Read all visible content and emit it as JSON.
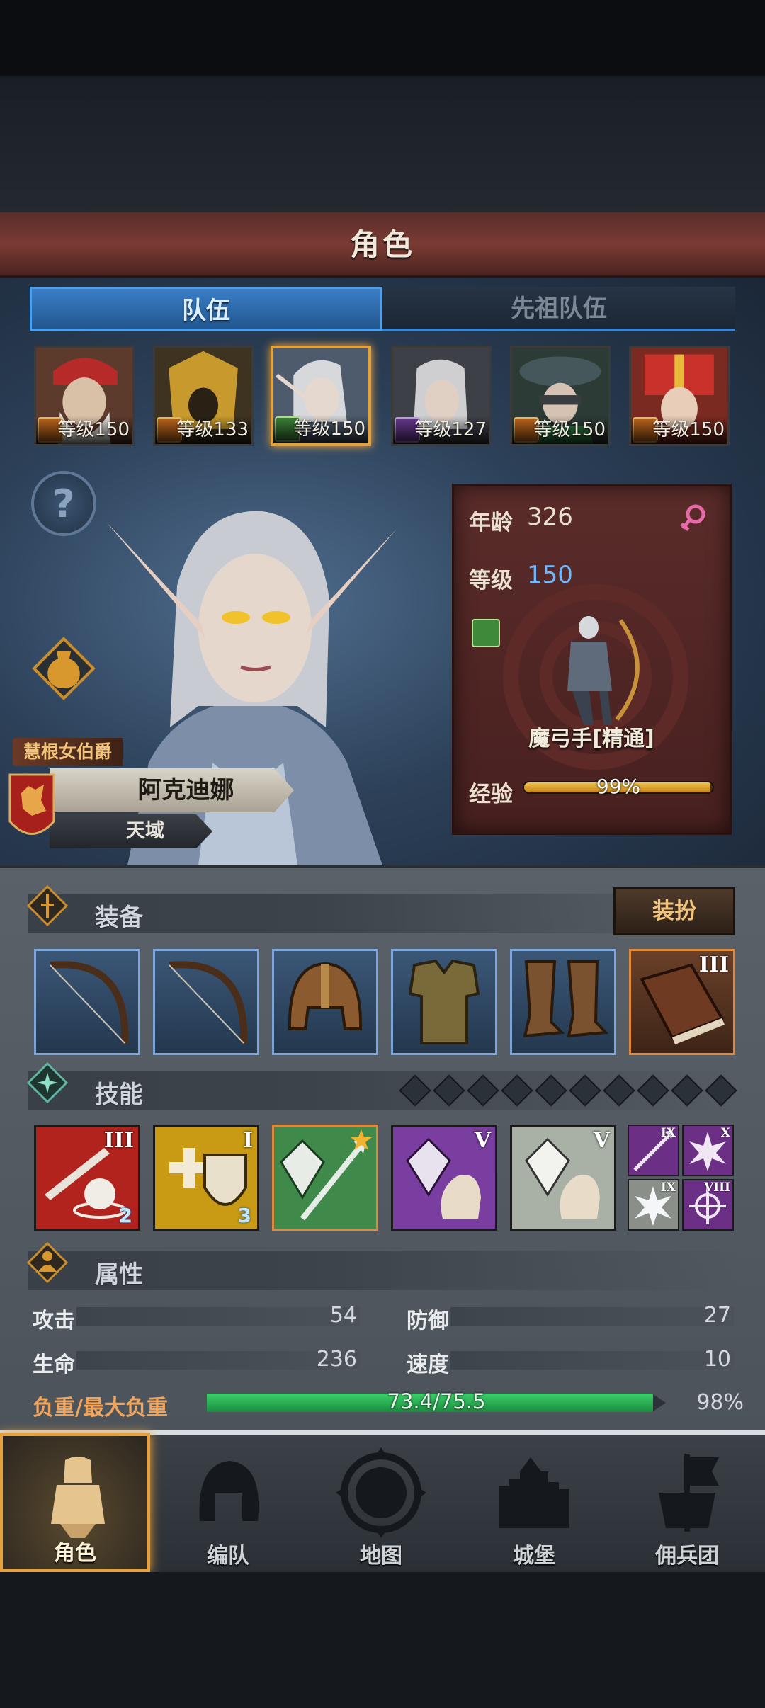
{
  "header": {
    "title": "角色"
  },
  "tabs": [
    {
      "label": "队伍",
      "active": true
    },
    {
      "label": "先祖队伍",
      "active": false
    }
  ],
  "party": [
    {
      "level": "等级150",
      "class_icon": "staff-icon"
    },
    {
      "level": "等级133",
      "class_icon": "horse-icon"
    },
    {
      "level": "等级150",
      "class_icon": "bow-icon",
      "selected": true
    },
    {
      "level": "等级127",
      "class_icon": "staff-icon"
    },
    {
      "level": "等级150",
      "class_icon": "horse-icon"
    },
    {
      "level": "等级150",
      "class_icon": "horse-icon"
    }
  ],
  "hero": {
    "title": "慧根女伯爵",
    "name": "阿克迪娜",
    "realm": "天域",
    "age_label": "年龄",
    "age": "326",
    "level_label": "等级",
    "level": "150",
    "gender_icon": "female-icon",
    "class_icon": "bow-icon",
    "class_name": "魔弓手[精通]",
    "exp_label": "经验",
    "exp_text": "99%",
    "exp_fraction": 0.99
  },
  "equipment": {
    "label": "装备",
    "outfit_button": "装扮",
    "slots": [
      {
        "name": "bow-icon"
      },
      {
        "name": "bow-icon"
      },
      {
        "name": "helmet-icon"
      },
      {
        "name": "armor-icon"
      },
      {
        "name": "boots-icon"
      },
      {
        "name": "book-icon",
        "rank": "III"
      }
    ]
  },
  "skills": {
    "label": "技能",
    "gem_count": 10,
    "items": [
      {
        "name": "sword-skill-icon",
        "rank": "III",
        "count": "2",
        "color": "#b2231d"
      },
      {
        "name": "shield-heal-skill-icon",
        "rank": "I",
        "count": "3",
        "color": "#c99a14"
      },
      {
        "name": "crystal-arrow-skill-icon",
        "rank": "",
        "count": "",
        "color": "#3f8a4b"
      },
      {
        "name": "crystal-hand-skill-icon",
        "rank": "V",
        "count": "",
        "color": "#7a3ea0"
      },
      {
        "name": "crystal-hand-skill-icon",
        "rank": "V",
        "count": "",
        "color": "#a9b0a5"
      }
    ],
    "small": [
      {
        "name": "arrow-passive-icon",
        "rank": "IX",
        "color": "#6b2f86"
      },
      {
        "name": "burst-passive-icon",
        "rank": "X",
        "color": "#6b2f86"
      },
      {
        "name": "ice-burst-passive-icon",
        "rank": "IX",
        "color": "#8a9089"
      },
      {
        "name": "target-passive-icon",
        "rank": "VIII",
        "color": "#6b2f86"
      }
    ]
  },
  "attributes": {
    "label": "属性",
    "attack_label": "攻击",
    "attack": "54",
    "defense_label": "防御",
    "defense": "27",
    "hp_label": "生命",
    "hp": "236",
    "speed_label": "速度",
    "speed": "10",
    "load_label": "负重/最大负重",
    "load_text": "73.4/75.5",
    "load_percent": "98%",
    "load_fraction": 0.972
  },
  "nav": [
    {
      "label": "角色",
      "icon": "knight-icon",
      "active": true
    },
    {
      "label": "编队",
      "icon": "helmet-icon"
    },
    {
      "label": "地图",
      "icon": "globe-icon"
    },
    {
      "label": "城堡",
      "icon": "castle-icon"
    },
    {
      "label": "佣兵团",
      "icon": "banner-icon"
    }
  ]
}
